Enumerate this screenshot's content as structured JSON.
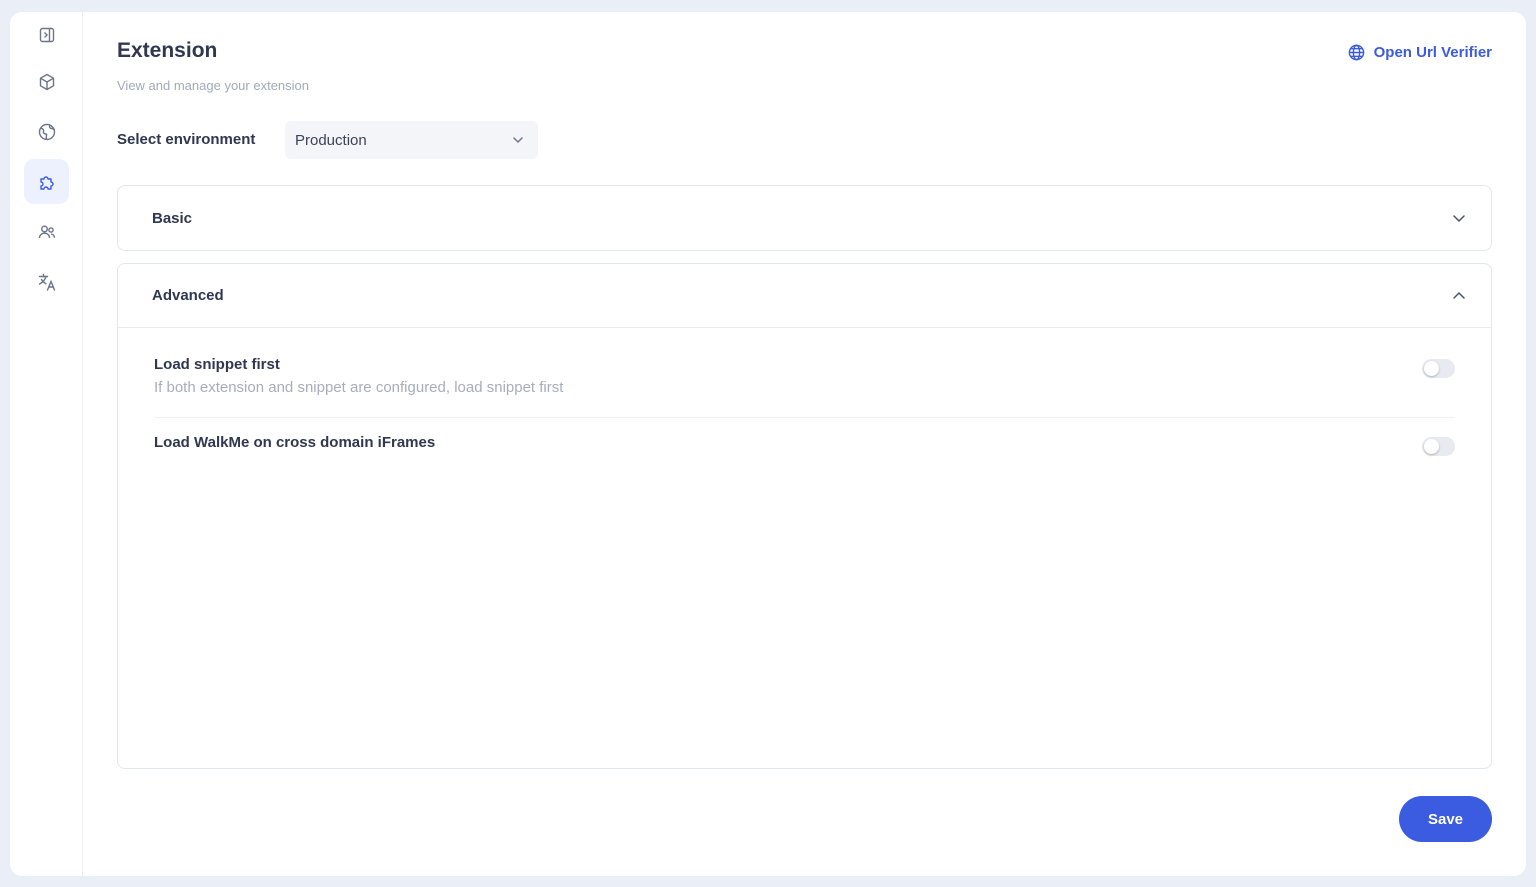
{
  "header": {
    "title": "Extension",
    "subtitle": "View and manage your extension",
    "url_verifier_label": "Open Url Verifier"
  },
  "sidebar": {
    "items": [
      {
        "icon": "collapse-panel-icon",
        "active": false
      },
      {
        "icon": "cube-icon",
        "active": false
      },
      {
        "icon": "globe-icon",
        "active": false
      },
      {
        "icon": "puzzle-icon",
        "active": true
      },
      {
        "icon": "users-icon",
        "active": false
      },
      {
        "icon": "translate-icon",
        "active": false
      }
    ]
  },
  "environment": {
    "label": "Select environment",
    "selected": "Production"
  },
  "sections": {
    "basic": {
      "title": "Basic",
      "expanded": false
    },
    "advanced": {
      "title": "Advanced",
      "expanded": true,
      "settings": [
        {
          "title": "Load snippet first",
          "description": "If both extension and snippet are configured, load snippet first",
          "enabled": false
        },
        {
          "title": "Load WalkMe on cross domain iFrames",
          "enabled": false
        }
      ]
    }
  },
  "actions": {
    "save_label": "Save"
  },
  "colors": {
    "accent": "#3b5be0",
    "background": "#e9eef7",
    "active_nav": "#edf1fd"
  }
}
